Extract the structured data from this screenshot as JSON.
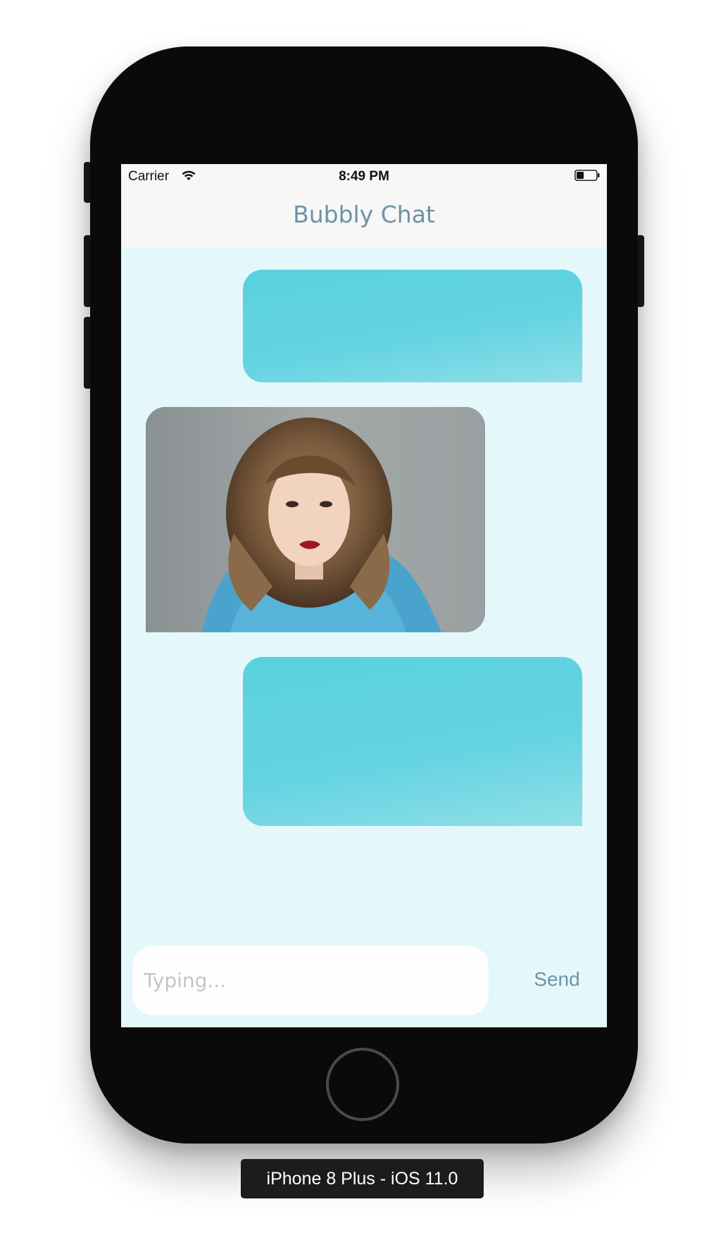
{
  "status_bar": {
    "carrier": "Carrier",
    "time": "8:49 PM",
    "wifi_icon": "wifi-icon",
    "battery_icon": "battery-icon"
  },
  "nav": {
    "title": "Bubbly Chat"
  },
  "messages": [
    {
      "direction": "outgoing",
      "kind": "text",
      "text": ""
    },
    {
      "direction": "incoming",
      "kind": "image",
      "image_icon": "portrait-photo"
    },
    {
      "direction": "outgoing",
      "kind": "text",
      "text": ""
    }
  ],
  "composer": {
    "placeholder": "Typing...",
    "value": "",
    "send_label": "Send"
  },
  "simulator": {
    "device_label": "iPhone 8 Plus - iOS 11.0"
  },
  "colors": {
    "background": "#e4f7fb",
    "bubble_outgoing": "#5ad1e0",
    "title": "#6e93a8",
    "send": "#6e93a8"
  }
}
